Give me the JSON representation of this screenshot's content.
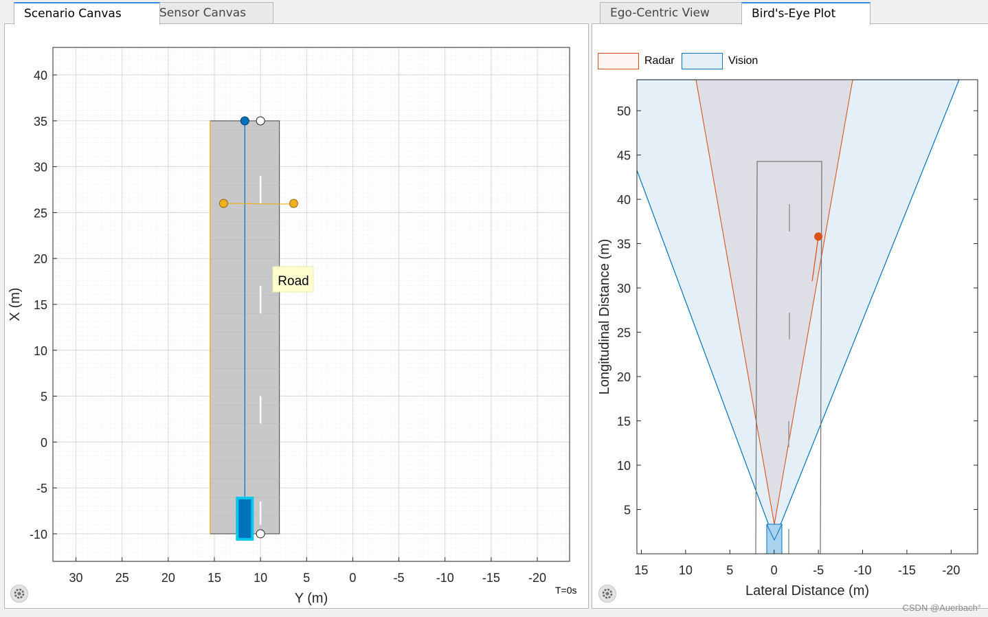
{
  "left_panel": {
    "tabs": [
      {
        "label": "Scenario Canvas",
        "active": true
      },
      {
        "label": "Sensor Canvas",
        "active": false
      }
    ],
    "toolbar": {
      "zoom_in": "zoom-in-icon",
      "zoom_out": "zoom-out-icon",
      "home": "home-icon"
    },
    "road_tooltip": "Road",
    "time_label": "T=0s",
    "chart_data": {
      "type": "scatter",
      "xlabel": "Y (m)",
      "ylabel": "X (m)",
      "xlim": [
        32.5,
        -23.5
      ],
      "ylim": [
        -13,
        43
      ],
      "xticks": [
        "30",
        "25",
        "20",
        "15",
        "10",
        "5",
        "0",
        "-5",
        "-10",
        "-15",
        "-20"
      ],
      "yticks": [
        "40",
        "35",
        "30",
        "25",
        "20",
        "15",
        "10",
        "5",
        "0",
        "-5",
        "-10"
      ],
      "road": {
        "center_start": [
          11.7,
          -10
        ],
        "center_end": [
          11.7,
          35
        ],
        "width_m": 7.5
      },
      "ego_vehicle": {
        "y": 11.7,
        "x": -8.5,
        "color": "#0072bd"
      },
      "sensor_points": [
        {
          "y": 14,
          "x": 26
        },
        {
          "y": 6.4,
          "x": 26
        }
      ],
      "colors": {
        "road": "#c8c8c8",
        "path": "#0072bd",
        "sensor": "#edb120",
        "ego_outline": "#00c8e8"
      }
    }
  },
  "right_panel": {
    "tabs": [
      {
        "label": "Ego-Centric View",
        "active": false
      },
      {
        "label": "Bird's-Eye Plot",
        "active": true
      }
    ],
    "legend": [
      {
        "label": "Radar",
        "color": "#d95319"
      },
      {
        "label": "Vision",
        "color": "#0072bd"
      }
    ],
    "chart_data": {
      "type": "scatter",
      "xlabel": "Lateral Distance (m)",
      "ylabel": "Longitudinal Distance (m)",
      "xlim": [
        15.5,
        -23
      ],
      "ylim": [
        0,
        53.5
      ],
      "xticks": [
        "15",
        "10",
        "5",
        "0",
        "-5",
        "-10",
        "-15",
        "-20"
      ],
      "yticks": [
        "50",
        "45",
        "40",
        "35",
        "30",
        "25",
        "20",
        "15",
        "10",
        "5"
      ],
      "radar_detection": {
        "lateral": -5,
        "longitudinal": 35.8
      },
      "colors": {
        "radar": "#d95319",
        "vision": "#0072bd",
        "vision_fill": "#e4eff8",
        "overlap_fill": "#dedfe6"
      }
    }
  },
  "watermark": "CSDN @Auerbach°"
}
